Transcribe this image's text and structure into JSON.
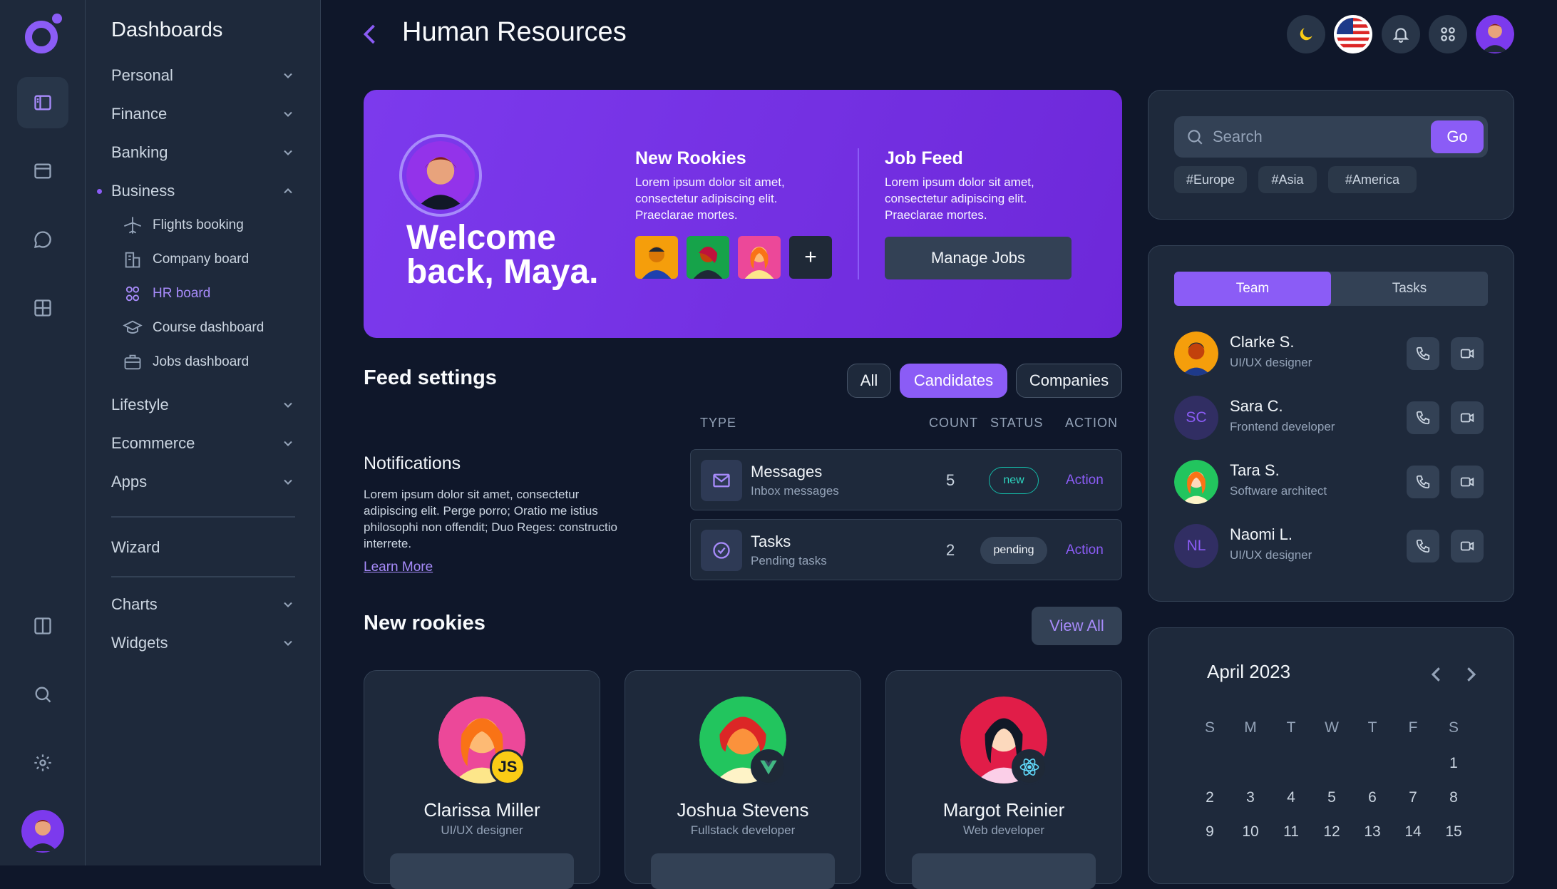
{
  "sidebar": {
    "title": "Dashboards",
    "menu": [
      {
        "label": "Personal"
      },
      {
        "label": "Finance"
      },
      {
        "label": "Banking"
      },
      {
        "label": "Business"
      },
      {
        "label": "Lifestyle"
      },
      {
        "label": "Ecommerce"
      },
      {
        "label": "Apps"
      }
    ],
    "business_items": [
      {
        "label": "Flights booking",
        "icon": "airplane-icon"
      },
      {
        "label": "Company board",
        "icon": "building-icon"
      },
      {
        "label": "HR board",
        "icon": "users-icon"
      },
      {
        "label": "Course dashboard",
        "icon": "graduation-cap-icon"
      },
      {
        "label": "Jobs dashboard",
        "icon": "briefcase-icon"
      }
    ],
    "wizard": "Wizard",
    "charts": "Charts",
    "widgets": "Widgets"
  },
  "header": {
    "title": "Human Resources"
  },
  "hero": {
    "welcome": "Welcome back, Maya.",
    "rookies_title": "New Rookies",
    "rookies_text": "Lorem ipsum dolor sit amet, consectetur adipiscing elit. Praeclarae mortes.",
    "add_label": "+",
    "jobs_title": "Job Feed",
    "jobs_text": "Lorem ipsum dolor sit amet, consectetur adipiscing elit. Praeclarae mortes.",
    "manage_label": "Manage Jobs"
  },
  "feed": {
    "title": "Feed settings",
    "filters": [
      "All",
      "Candidates",
      "Companies"
    ],
    "active_filter": "Candidates",
    "columns": [
      "TYPE",
      "COUNT",
      "STATUS",
      "ACTION"
    ],
    "notif_title": "Notifications",
    "notif_text": "Lorem ipsum dolor sit amet, consectetur adipiscing elit. Perge porro; Oratio me istius philosophi non offendit; Duo Reges: constructio interrete.",
    "learn_more": "Learn More",
    "rows": [
      {
        "title": "Messages",
        "subtitle": "Inbox messages",
        "count": "5",
        "status": "new",
        "action": "Action"
      },
      {
        "title": "Tasks",
        "subtitle": "Pending tasks",
        "count": "2",
        "status": "pending",
        "action": "Action"
      }
    ]
  },
  "rookies": {
    "title": "New rookies",
    "view_all": "View All",
    "cards": [
      {
        "name": "Clarissa Miller",
        "role": "UI/UX designer",
        "badge": "JS"
      },
      {
        "name": "Joshua Stevens",
        "role": "Fullstack developer",
        "badge": "vue-icon"
      },
      {
        "name": "Margot Reinier",
        "role": "Web developer",
        "badge": "react-icon"
      }
    ]
  },
  "search": {
    "placeholder": "Search",
    "go": "Go",
    "tags": [
      "#Europe",
      "#Asia",
      "#America"
    ]
  },
  "team": {
    "tabs": [
      "Team",
      "Tasks"
    ],
    "active_tab": "Team",
    "members": [
      {
        "name": "Clarke S.",
        "role": "UI/UX designer",
        "initials": ""
      },
      {
        "name": "Sara C.",
        "role": "Frontend developer",
        "initials": "SC"
      },
      {
        "name": "Tara S.",
        "role": "Software architect",
        "initials": ""
      },
      {
        "name": "Naomi L.",
        "role": "UI/UX designer",
        "initials": "NL"
      }
    ]
  },
  "calendar": {
    "month": "April 2023",
    "weekdays": [
      "S",
      "M",
      "T",
      "W",
      "T",
      "F",
      "S"
    ],
    "visible_days": [
      "1",
      "2",
      "3",
      "4",
      "5",
      "6",
      "7",
      "8",
      "9",
      "10",
      "11",
      "12",
      "13",
      "14",
      "15"
    ]
  },
  "colors": {
    "accent": "#8b5cf6",
    "hero": "#7c3aed",
    "bg": "#0f172a",
    "panel": "#1e293b"
  }
}
